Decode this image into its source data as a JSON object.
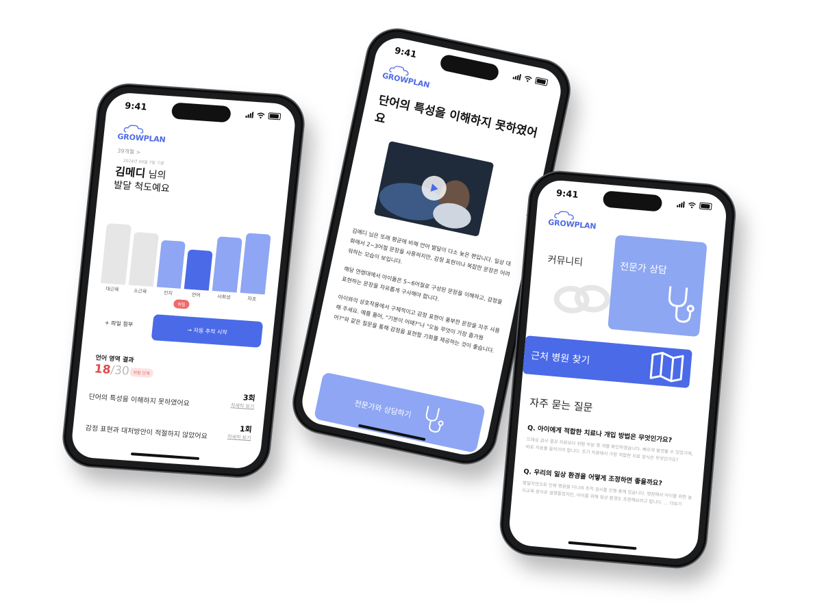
{
  "status": {
    "time": "9:41"
  },
  "brand": {
    "logo": "GROWPLAN",
    "accent": "#4a6ae8",
    "light_accent": "#8ea6f3"
  },
  "screen1": {
    "age": "39개월 >",
    "date": "2024년 09월 7일 기준",
    "child_name": "김메디",
    "name_suffix": " 님의",
    "subtitle": "발달 척도예요",
    "domains": [
      "대근육",
      "소근육",
      "인지",
      "언어",
      "사회성",
      "자조"
    ],
    "levels": [
      0.8,
      0.71,
      0.63,
      0.53,
      0.73,
      0.8
    ],
    "level_colors": [
      "#e6e6e6",
      "#e6e6e6",
      "#8ea6f3",
      "#4a6ae8",
      "#8ea6f3",
      "#8ea6f3"
    ],
    "risk_badge": "위험",
    "attach_label": "+ 파일 첨부",
    "start_label": "→  자동 추적 시작",
    "lang_section": "언어 영역 결과",
    "score": "18",
    "score_total": "/30",
    "score_badge": "위험 단계",
    "results": [
      {
        "text": "단어의 특성을 이해하지 못하였어요",
        "count": "3회",
        "detail": "자세히 보기"
      },
      {
        "text": "감정 표현과 대처방안이 적절하지 않았어요",
        "count": "1회",
        "detail": "자세히 보기"
      }
    ]
  },
  "screen2": {
    "title": "단어의 특성을 이해하지 못하였어요",
    "paragraphs": [
      "김메디 님은 또래 평균에 비해 언어 발달이 다소 늦은 편입니다. 일상 대화에서 2~3어절 문장을 사용하지만, 감정 표현이나 복잡한 문장은 어려워하는 모습이 보입니다.",
      "해당 연령대에서 아이들은 5~6어절로 구성된 문장을 이해하고, 감정을 표현하는 문장을 자유롭게 구사해야 합니다.",
      "아이와의 상호작용에서 구체적이고 감정 표현이 풍부한 문장을 자주 사용해 주세요. 예를 들어, \"기분이 어때?\"나 \"오늘 무엇이 가장 즐거웠어?\"와 같은 질문을 통해 감정을 표현할 기회를 제공하는 것이 좋습니다."
    ],
    "cta": "전문가와 상담하기"
  },
  "screen3": {
    "community": "커뮤니티",
    "expert": "전문가 상담",
    "hospital": "근처 병원 찾기",
    "faq_title": "자주 묻는 질문",
    "faqs": [
      {
        "q": "Q. 아이에게 적합한 치료나 개입 방법은 무엇인가요?",
        "a": "드레싱 검사 결과 치료보다 위험 부분 몇 개를 확인하였습니다. 빠르게 발견될 수 있었기에, 바로 치료를 들어가야 합니다. 조기 치료에서 가장 적합한 치료 방식은 무엇인가요?"
      },
      {
        "q": "Q. 우리의 일상 환경을 어떻게 조정하면 좋을까요?",
        "a": "발달지연으로 인해 병원을 다니며 추적 검사를 진행 중에 있습니다. 병원에서 아이를 위한 놀이교육 방식은 설명들었지만, 아이를 위해 일상 환경도 조정해보려고 합니다. ... 더보기"
      }
    ]
  }
}
